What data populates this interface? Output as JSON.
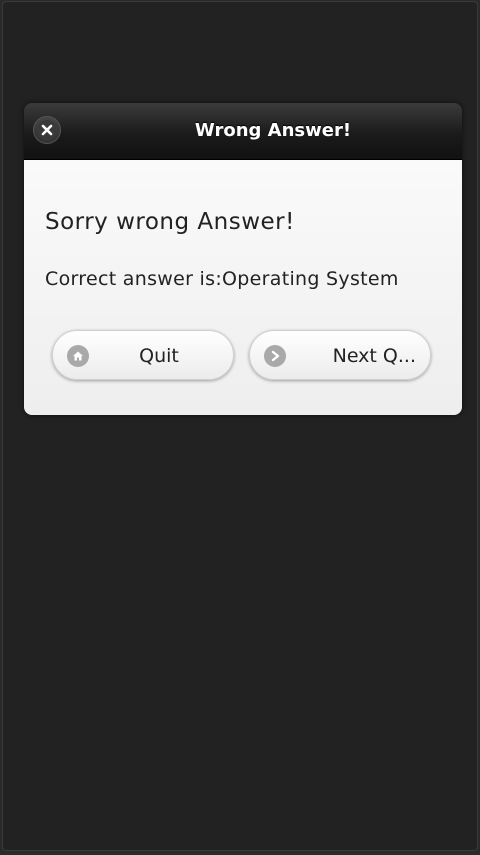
{
  "dialog": {
    "title": "Wrong Answer!",
    "close_icon": "close-icon",
    "headline": "Sorry wrong Answer!",
    "answer_text": "Correct answer is:Operating System",
    "buttons": [
      {
        "label": "Quit",
        "icon": "home-icon"
      },
      {
        "label": "Next Q...",
        "icon": "arrow-right-icon"
      }
    ]
  },
  "colors": {
    "background": "#222222",
    "header": "#1b1b1b",
    "content": "#f5f5f5",
    "icon": "#a9a9a9"
  }
}
